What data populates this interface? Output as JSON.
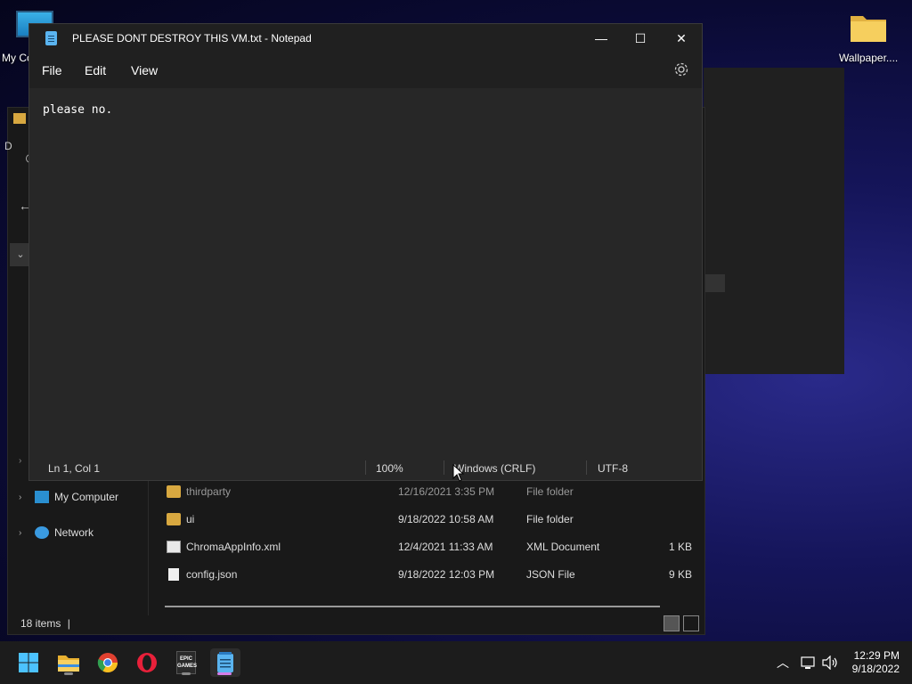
{
  "desktop": {
    "icons": [
      {
        "label": "My Co"
      },
      {
        "label": "Wallpaper...."
      }
    ]
  },
  "explorer": {
    "peek_letters": [
      "D"
    ],
    "nav": [
      {
        "label": "My Computer"
      },
      {
        "label": "Network"
      }
    ],
    "files": [
      {
        "name": "thirdparty",
        "date": "12/16/2021 3:35 PM",
        "type": "File folder",
        "size": ""
      },
      {
        "name": "ui",
        "date": "9/18/2022 10:58 AM",
        "type": "File folder",
        "size": ""
      },
      {
        "name": "ChromaAppInfo.xml",
        "date": "12/4/2021 11:33 AM",
        "type": "XML Document",
        "size": "1 KB"
      },
      {
        "name": "config.json",
        "date": "9/18/2022 12:03 PM",
        "type": "JSON File",
        "size": "9 KB"
      }
    ],
    "status": {
      "items": "18 items",
      "caret": "|"
    }
  },
  "notepad": {
    "title": "PLEASE DONT DESTROY THIS VM.txt - Notepad",
    "menu": [
      "File",
      "Edit",
      "View"
    ],
    "content": "please no.",
    "status": {
      "position": "Ln 1, Col 1",
      "zoom": "100%",
      "line_ending": "Windows (CRLF)",
      "encoding": "UTF-8"
    },
    "buttons": {
      "minimize": "—",
      "maximize": "☐",
      "close": "✕"
    }
  },
  "taskbar": {
    "apps": [
      "start-icon",
      "file-explorer-icon",
      "chrome-icon",
      "opera-icon",
      "epic-games-icon",
      "notepad-icon"
    ],
    "epic_label": "EPIC GAMES",
    "clock": {
      "time": "12:29 PM",
      "date": "9/18/2022"
    }
  },
  "colors": {
    "accent_indicator": "#d57ee8",
    "notepad_bg": "#272727",
    "folder": "#d8a840"
  }
}
